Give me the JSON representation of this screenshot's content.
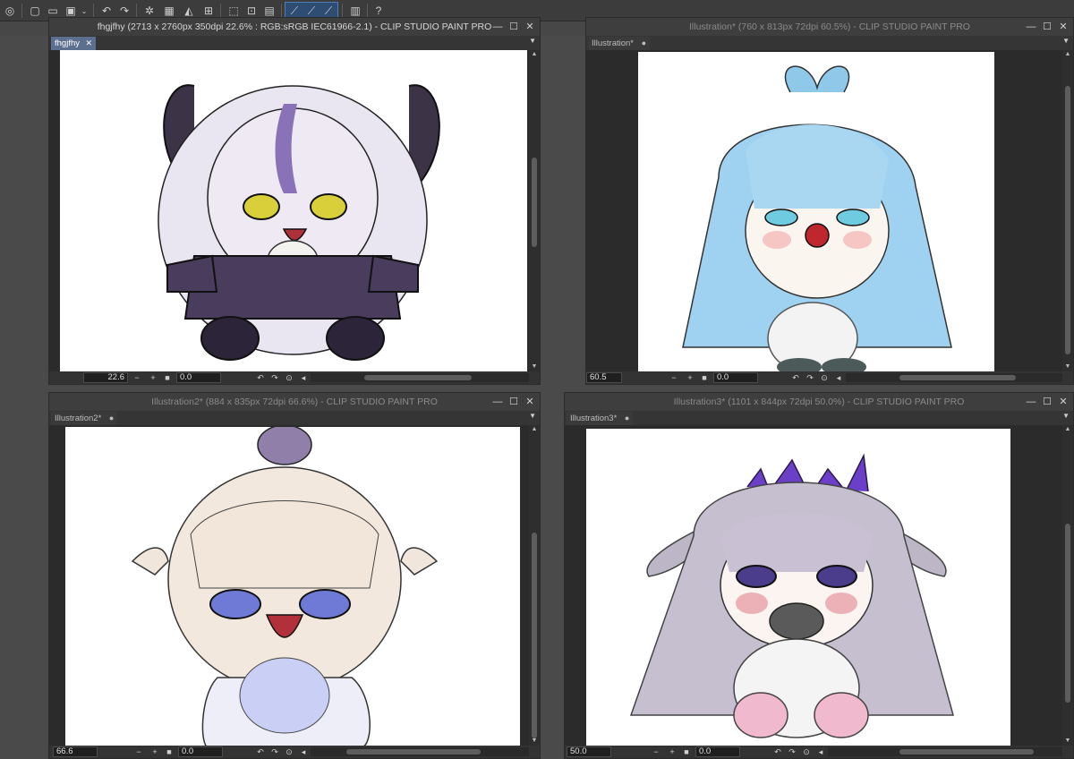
{
  "toolbar": {
    "icons": [
      "app-logo-icon",
      "new-file-icon",
      "open-file-icon",
      "save-icon",
      "dropdown-icon",
      "undo-icon",
      "redo-icon",
      "clear-icon",
      "fill-icon",
      "transform-icon",
      "crop-icon",
      "select-all-icon",
      "deselect-icon",
      "ruler-icon",
      "snap-ruler-icon",
      "snap-grid-icon",
      "snap-special-icon",
      "palette-icon",
      "help-icon"
    ]
  },
  "windows": [
    {
      "title": "fhgjfhy (2713 x 2760px 350dpi 22.6% : RGB:sRGB IEC61966-2.1)  - CLIP STUDIO PAINT PRO",
      "tab": "fhgjfhy",
      "tab_close": "✕",
      "zoom": "22.6",
      "angle": "0.0",
      "active": true
    },
    {
      "title": "Illustration* (760 x 813px 72dpi 60.5%)  - CLIP STUDIO PAINT PRO",
      "tab": "Illustration*",
      "tab_close": "●",
      "zoom": "60.5",
      "angle": "0.0",
      "active": false
    },
    {
      "title": "Illustration2* (884 x 835px 72dpi 66.6%)  - CLIP STUDIO PAINT PRO",
      "tab": "Illustration2*",
      "tab_close": "●",
      "zoom": "66.6",
      "angle": "0.0",
      "active": false
    },
    {
      "title": "Illustration3* (1101 x 844px 72dpi 50.0%)  - CLIP STUDIO PAINT PRO",
      "tab": "Illustration3*",
      "tab_close": "●",
      "zoom": "50.0",
      "angle": "0.0",
      "active": false
    }
  ],
  "colors": {
    "accent": "#5c6f8f",
    "window_bg": "#3a3a3a",
    "canvas_bg": "#2b2b2b",
    "paper": "#ffffff"
  }
}
